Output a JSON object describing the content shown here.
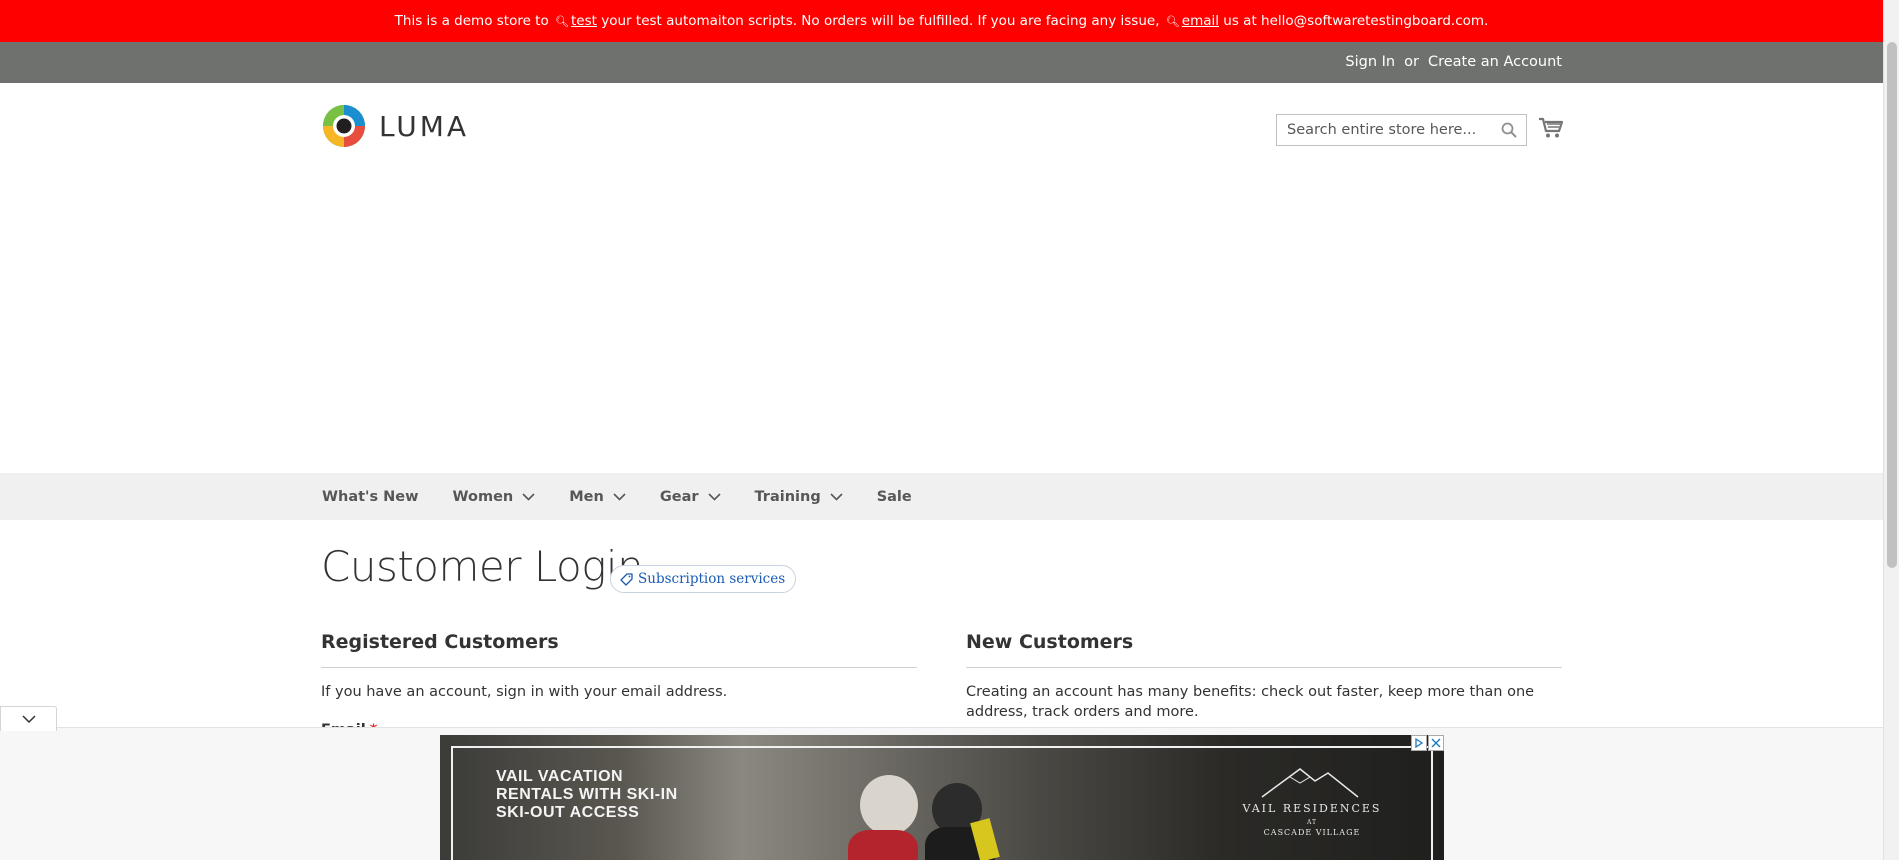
{
  "banner": {
    "part1": "This is a demo store to",
    "link1": "test",
    "part2": "your test automaiton scripts. No orders will be fulfilled. If you are facing any issue,",
    "link2": "email",
    "part3": "us at hello@softwaretestingboard.com.",
    "icon": "search-magnifier-icon",
    "background": "#ff0000"
  },
  "header": {
    "sign_in": "Sign In",
    "or": "or",
    "create_account": "Create an Account",
    "logo_text": "LUMA",
    "search_placeholder": "Search entire store here...",
    "cart_icon": "cart-icon",
    "panel_color": "#6e716e"
  },
  "nav": {
    "items": [
      {
        "label": "What's New",
        "dropdown": false
      },
      {
        "label": "Women",
        "dropdown": true
      },
      {
        "label": "Men",
        "dropdown": true
      },
      {
        "label": "Gear",
        "dropdown": true
      },
      {
        "label": "Training",
        "dropdown": true
      },
      {
        "label": "Sale",
        "dropdown": false
      }
    ]
  },
  "page": {
    "title": "Customer Login",
    "badge": "Subscription services"
  },
  "registered": {
    "title": "Registered Customers",
    "text": "If you have an account, sign in with your email address.",
    "email_label": "Email",
    "required_mark": "*"
  },
  "new_customers": {
    "title": "New Customers",
    "text": "Creating an account has many benefits: check out faster, keep more than one address, track orders and more."
  },
  "ad": {
    "headline": [
      "VAIL VACATION",
      "RENTALS WITH SKI-IN",
      "SKI-OUT ACCESS"
    ],
    "brand": "VAIL RESIDENCES",
    "brand_sub": "CASCADE VILLAGE",
    "brand_at": "AT"
  }
}
